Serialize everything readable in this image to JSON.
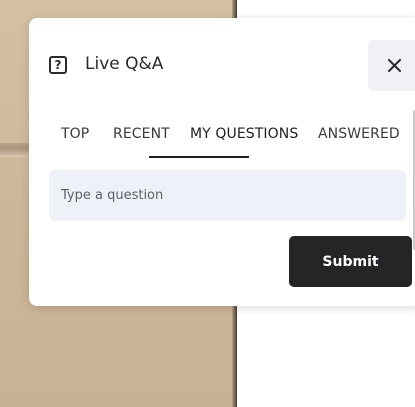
{
  "panel": {
    "title": "Live Q&A",
    "icon": "question-square-icon",
    "close_icon": "close-icon"
  },
  "tabs": [
    {
      "label": "TOP",
      "active": false
    },
    {
      "label": "RECENT",
      "active": false
    },
    {
      "label": "MY QUESTIONS",
      "active": true
    },
    {
      "label": "ANSWERED",
      "active": false
    }
  ],
  "question_input": {
    "placeholder": "Type a question",
    "value": ""
  },
  "submit": {
    "label": "Submit"
  },
  "colors": {
    "panel_bg": "#ffffff",
    "input_bg": "#eef1f7",
    "close_bg": "#eff1f6",
    "submit_bg": "#252528",
    "active_tab_indicator": "#1e1e1e"
  }
}
